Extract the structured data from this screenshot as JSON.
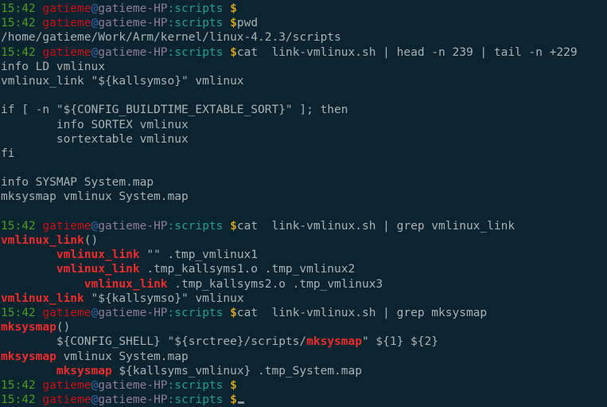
{
  "terminal": {
    "background_color": "#0b2430",
    "foreground_color": "#a9b3b3",
    "colors": {
      "time": "#4e9a22",
      "user": "#cc0f16",
      "at": "#3465a4",
      "host": "#8f7d99",
      "path": "#1f9e96",
      "dollar": "#d0a215",
      "grep_match": "#ee2b2b",
      "cursor": "#8a9292"
    },
    "prompt": {
      "time": "15:42",
      "user": "gatieme",
      "at": "@",
      "host": "gatieme-HP",
      "cwd": ":scripts",
      "symbol": "$"
    },
    "lines": [
      {
        "type": "prompt",
        "command": ""
      },
      {
        "type": "prompt",
        "command": "pwd"
      },
      {
        "type": "output",
        "text": "/home/gatieme/Work/Arm/kernel/linux-4.2.3/scripts"
      },
      {
        "type": "prompt",
        "command": "cat  link-vmlinux.sh | head -n 239 | tail -n +229"
      },
      {
        "type": "output",
        "text": "info LD vmlinux"
      },
      {
        "type": "output",
        "text": "vmlinux_link \"${kallsymso}\" vmlinux"
      },
      {
        "type": "output",
        "text": ""
      },
      {
        "type": "output",
        "text": "if [ -n \"${CONFIG_BUILDTIME_EXTABLE_SORT}\" ]; then"
      },
      {
        "type": "output",
        "text": "        info SORTEX vmlinux"
      },
      {
        "type": "output",
        "text": "        sortextable vmlinux"
      },
      {
        "type": "output",
        "text": "fi"
      },
      {
        "type": "output",
        "text": ""
      },
      {
        "type": "output",
        "text": "info SYSMAP System.map"
      },
      {
        "type": "output",
        "text": "mksysmap vmlinux System.map"
      },
      {
        "type": "output",
        "text": ""
      },
      {
        "type": "prompt",
        "command": "cat  link-vmlinux.sh | grep vmlinux_link"
      },
      {
        "type": "grep",
        "segments": [
          {
            "t": "vmlinux_link",
            "m": true
          },
          {
            "t": "()",
            "m": false
          }
        ]
      },
      {
        "type": "grep",
        "segments": [
          {
            "t": "        ",
            "m": false
          },
          {
            "t": "vmlinux_link",
            "m": true
          },
          {
            "t": " \"\" .tmp_vmlinux1",
            "m": false
          }
        ]
      },
      {
        "type": "grep",
        "segments": [
          {
            "t": "        ",
            "m": false
          },
          {
            "t": "vmlinux_link",
            "m": true
          },
          {
            "t": " .tmp_kallsyms1.o .tmp_vmlinux2",
            "m": false
          }
        ]
      },
      {
        "type": "grep",
        "segments": [
          {
            "t": "            ",
            "m": false
          },
          {
            "t": "vmlinux_link",
            "m": true
          },
          {
            "t": " .tmp_kallsyms2.o .tmp_vmlinux3",
            "m": false
          }
        ]
      },
      {
        "type": "grep",
        "segments": [
          {
            "t": "vmlinux_link",
            "m": true
          },
          {
            "t": " \"${kallsymso}\" vmlinux",
            "m": false
          }
        ]
      },
      {
        "type": "prompt",
        "command": "cat  link-vmlinux.sh | grep mksysmap"
      },
      {
        "type": "grep",
        "segments": [
          {
            "t": "mksysmap",
            "m": true
          },
          {
            "t": "()",
            "m": false
          }
        ]
      },
      {
        "type": "grep",
        "segments": [
          {
            "t": "        ${CONFIG_SHELL} \"${srctree}/scripts/",
            "m": false
          },
          {
            "t": "mksysmap",
            "m": true
          },
          {
            "t": "\" ${1} ${2}",
            "m": false
          }
        ]
      },
      {
        "type": "grep",
        "segments": [
          {
            "t": "mksysmap",
            "m": true
          },
          {
            "t": " vmlinux System.map",
            "m": false
          }
        ]
      },
      {
        "type": "grep",
        "segments": [
          {
            "t": "        ",
            "m": false
          },
          {
            "t": "mksysmap",
            "m": true
          },
          {
            "t": " ${kallsyms_vmlinux} .tmp_System.map",
            "m": false
          }
        ]
      },
      {
        "type": "prompt",
        "command": ""
      },
      {
        "type": "prompt",
        "command": "",
        "cursor": true
      }
    ]
  }
}
